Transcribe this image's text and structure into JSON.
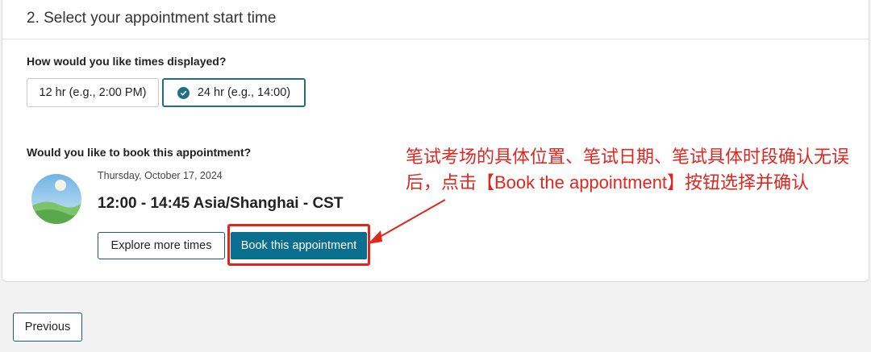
{
  "section": {
    "title": "2. Select your appointment start time"
  },
  "time_format": {
    "question": "How would you like times displayed?",
    "option_12": "12 hr (e.g., 2:00 PM)",
    "option_24": "24 hr (e.g., 14:00)",
    "selected": "24 hr"
  },
  "booking": {
    "question": "Would you like to book this appointment?",
    "date": "Thursday, October 17, 2024",
    "time": "12:00 - 14:45 Asia/Shanghai - CST",
    "explore_label": "Explore more times",
    "book_label": "Book this appointment"
  },
  "annotation": {
    "text": "笔试考场的具体位置、笔试日期、笔试具体时段确认无误后，点击【Book the appointment】按钮选择并确认",
    "color": "#e0261e"
  },
  "footer": {
    "previous_label": "Previous"
  },
  "colors": {
    "accent": "#0a6e8f",
    "border_accent": "#1f5b6e"
  }
}
